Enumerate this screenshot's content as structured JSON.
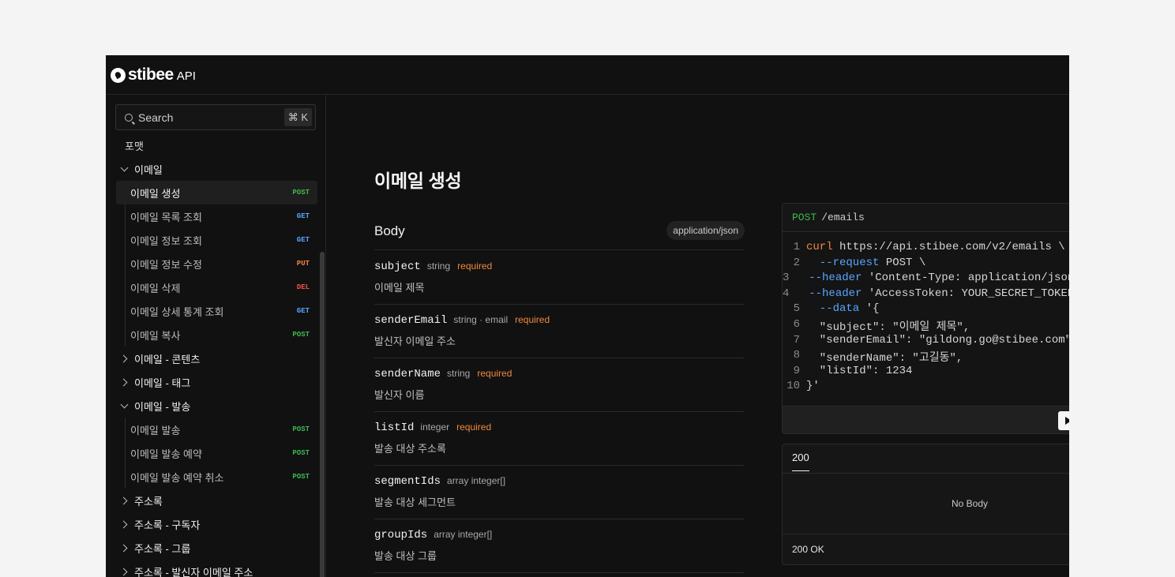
{
  "header": {
    "logo_text": "stibee",
    "logo_suffix": "API"
  },
  "search": {
    "placeholder": "Search",
    "shortcut": "⌘ K"
  },
  "sidebar": {
    "format_label": "포맷",
    "groups": [
      {
        "label": "이메일",
        "expanded": true,
        "items": [
          {
            "label": "이메일 생성",
            "method": "POST",
            "active": true
          },
          {
            "label": "이메일 목록 조회",
            "method": "GET"
          },
          {
            "label": "이메일 정보 조회",
            "method": "GET"
          },
          {
            "label": "이메일 정보 수정",
            "method": "PUT"
          },
          {
            "label": "이메일 삭제",
            "method": "DEL"
          },
          {
            "label": "이메일 상세 통계 조회",
            "method": "GET"
          },
          {
            "label": "이메일 복사",
            "method": "POST"
          }
        ]
      },
      {
        "label": "이메일 - 콘텐츠",
        "expanded": false
      },
      {
        "label": "이메일 - 태그",
        "expanded": false
      },
      {
        "label": "이메일 - 발송",
        "expanded": true,
        "items": [
          {
            "label": "이메일 발송",
            "method": "POST"
          },
          {
            "label": "이메일 발송 예약",
            "method": "POST"
          },
          {
            "label": "이메일 발송 예약 취소",
            "method": "POST"
          }
        ]
      },
      {
        "label": "주소록",
        "expanded": false
      },
      {
        "label": "주소록 - 구독자",
        "expanded": false
      },
      {
        "label": "주소록 - 그룹",
        "expanded": false
      },
      {
        "label": "주소록 - 발신자 이메일 주소",
        "expanded": false
      }
    ]
  },
  "main": {
    "title": "이메일 생성",
    "body_label": "Body",
    "content_type": "application/json",
    "params": [
      {
        "name": "subject",
        "type": "string",
        "required": "required",
        "desc": "이메일 제목"
      },
      {
        "name": "senderEmail",
        "type": "string · email",
        "required": "required",
        "desc": "발신자 이메일 주소"
      },
      {
        "name": "senderName",
        "type": "string",
        "required": "required",
        "desc": "발신자 이름"
      },
      {
        "name": "listId",
        "type": "integer",
        "required": "required",
        "desc": "발송 대상 주소록"
      },
      {
        "name": "segmentIds",
        "type": "array integer[]",
        "required": "",
        "desc": "발송 대상 세그먼트"
      },
      {
        "name": "groupIds",
        "type": "array integer[]",
        "required": "",
        "desc": "발송 대상 그룹"
      }
    ]
  },
  "code": {
    "method": "POST",
    "path": "/emails",
    "lines": [
      {
        "n": "1",
        "parts": [
          {
            "t": "curl",
            "c": "cmd"
          },
          {
            "t": " https://api.stibee.com/v2/emails \\",
            "c": "txt"
          }
        ]
      },
      {
        "n": "2",
        "parts": [
          {
            "t": "  --request",
            "c": "flag"
          },
          {
            "t": " POST \\",
            "c": "txt"
          }
        ]
      },
      {
        "n": "3",
        "parts": [
          {
            "t": "  --header",
            "c": "flag"
          },
          {
            "t": " 'Content-Type: application/json' \\",
            "c": "txt"
          }
        ]
      },
      {
        "n": "4",
        "parts": [
          {
            "t": "  --header",
            "c": "flag"
          },
          {
            "t": " 'AccessToken: YOUR_SECRET_TOKEN' \\",
            "c": "txt"
          }
        ]
      },
      {
        "n": "5",
        "parts": [
          {
            "t": "  --data",
            "c": "flag"
          },
          {
            "t": " '{",
            "c": "txt"
          }
        ]
      },
      {
        "n": "6",
        "parts": [
          {
            "t": "  \"subject\": \"이메일 제목\",",
            "c": "txt"
          }
        ]
      },
      {
        "n": "7",
        "parts": [
          {
            "t": "  \"senderEmail\": \"gildong.go@stibee.com\",",
            "c": "txt"
          }
        ]
      },
      {
        "n": "8",
        "parts": [
          {
            "t": "  \"senderName\": \"고길동\",",
            "c": "txt"
          }
        ]
      },
      {
        "n": "9",
        "parts": [
          {
            "t": "  \"listId\": 1234",
            "c": "txt"
          }
        ]
      },
      {
        "n": "10",
        "parts": [
          {
            "t": "}'",
            "c": "txt"
          }
        ]
      }
    ]
  },
  "response": {
    "tab": "200",
    "empty": "No Body",
    "status": "200 OK"
  }
}
